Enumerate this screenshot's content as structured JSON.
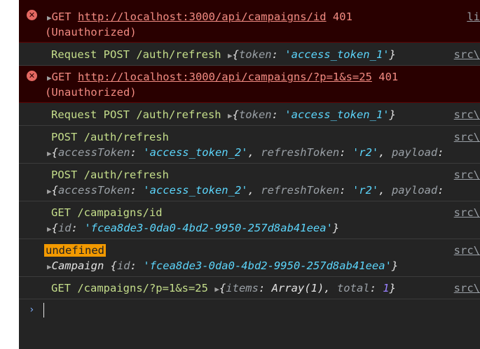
{
  "rows": [
    {
      "method": "GET",
      "url": "http://localhost:3000/api/campaigns/id",
      "status": "401",
      "status_text": "(Unauthorized)",
      "source": "li"
    },
    {
      "prefix": "Request POST /auth/refresh",
      "obj_open": "{",
      "key": "token",
      "value": "'access_token_1'",
      "obj_close": "}",
      "source": "src\\"
    },
    {
      "method": "GET",
      "url": "http://localhost:3000/api/campaigns/?p=1&s=25",
      "status": "401",
      "status_text": "(Unauthorized)",
      "source": ""
    },
    {
      "prefix": "Request POST /auth/refresh",
      "obj_open": "{",
      "key": "token",
      "value": "'access_token_1'",
      "obj_close": "}",
      "source": "src\\"
    },
    {
      "title": "POST /auth/refresh",
      "k1": "accessToken",
      "v1": "'access_token_2'",
      "k2": "refreshToken",
      "v2": "'r2'",
      "k3": "payload",
      "source": "src\\"
    },
    {
      "title": "POST /auth/refresh",
      "k1": "accessToken",
      "v1": "'access_token_2'",
      "k2": "refreshToken",
      "v2": "'r2'",
      "k3": "payload",
      "source": "src\\"
    },
    {
      "title": "GET /campaigns/id",
      "k1": "id",
      "v1": "'fcea8de3-0da0-4bd2-9950-257d8ab41eea'",
      "source": "src\\"
    },
    {
      "badge": "undefined",
      "class_name": "Campaign",
      "k1": "id",
      "v1": "'fcea8de3-0da0-4bd2-9950-257d8ab41eea'",
      "source": "src\\"
    },
    {
      "prefix": "GET /campaigns/?p=1&s=25",
      "k1": "items",
      "v1": "Array(1)",
      "k2": "total",
      "v2": "1",
      "source": "src\\"
    }
  ],
  "prompt_glyph": "›",
  "icons": {
    "error": "error-icon",
    "expand": "expand-triangle-icon",
    "prompt": "chevron-right-icon"
  },
  "colors": {
    "background": "#242424",
    "error_bg": "#290000",
    "error_text": "#f28b82",
    "green": "#c5de8b",
    "string": "#5cd5fb",
    "number": "#9980ff",
    "badge": "#f29900"
  }
}
